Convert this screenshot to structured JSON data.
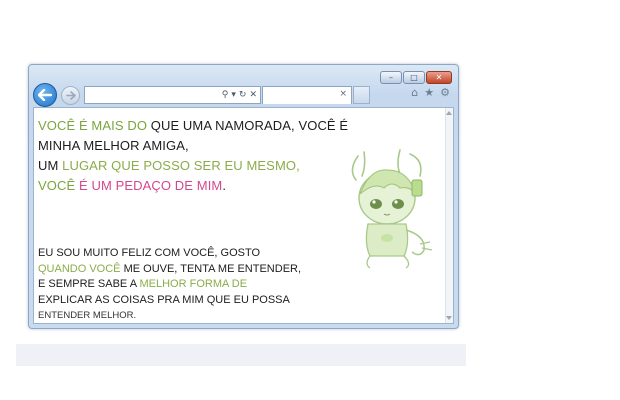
{
  "browser": {
    "caption_buttons": {
      "minimize": "–",
      "maximize": "□",
      "close": "✕"
    },
    "nav": {
      "back_icon": "arrow-left-icon",
      "forward_icon": "arrow-right-icon"
    },
    "address_tools": {
      "search": "⚲",
      "dropdown": "▾",
      "refresh": "↻",
      "stop": "✕"
    },
    "tab_close": "×",
    "toolbar": {
      "home": "⌂",
      "favorites": "★",
      "settings": "⚙"
    }
  },
  "content": {
    "para1": {
      "line1": {
        "a": "VOCÊ É MAIS DO ",
        "b": "QUE UMA NAMORADA, VOCÊ É"
      },
      "line2": "MINHA MELHOR AMIGA,",
      "line3": {
        "a": " UM ",
        "b": "LUGAR QUE POSSO SER EU MESMO,"
      },
      "line4": {
        "a": "VOCÊ ",
        "b": "É UM PEDAÇO DE MIM",
        "c": "."
      }
    },
    "para2": {
      "line1": "EU SOU MUITO FELIZ COM VOCÊ, GOSTO",
      "line2": {
        "a": "QUANDO VOCÊ ",
        "b": "ME OUVE, TENTA ME ENTENDER,"
      },
      "line3": {
        "a": "E  SEMPRE  SABE  A  ",
        "b": "MELHOR FORMA DE"
      },
      "line4": "EXPLICAR AS COISAS PRA MIM QUE EU POSSA",
      "line5": "ENTENDER MELHOR."
    }
  },
  "colors": {
    "green": "#7aa53c",
    "pink": "#d4478c",
    "frame": "#c5d8ee"
  }
}
